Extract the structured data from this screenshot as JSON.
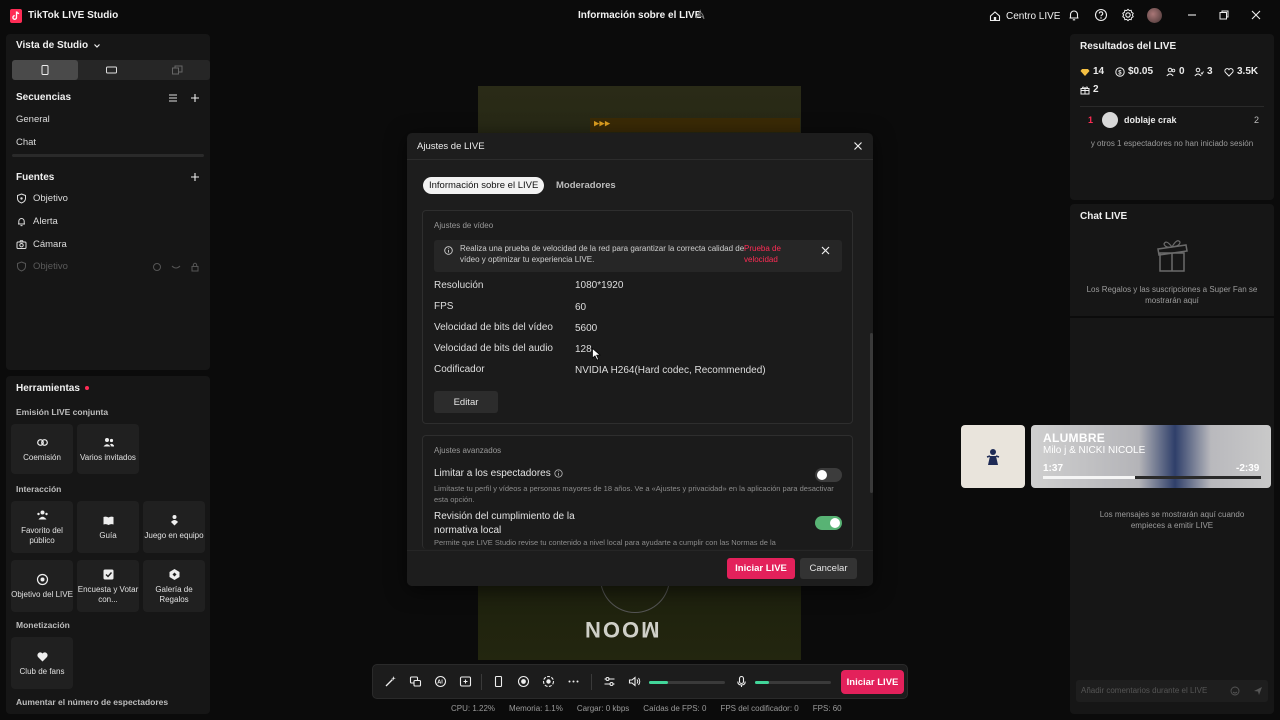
{
  "titlebar": {
    "app_name": "TikTok LIVE Studio",
    "center_title": "Información sobre el LIVE",
    "hub_label": "Centro LIVE"
  },
  "left": {
    "studio_view": "Vista de Studio",
    "sequences_header": "Secuencias",
    "sequences": [
      "General",
      "Chat"
    ],
    "sources_header": "Fuentes",
    "sources": [
      "Objetivo",
      "Alerta",
      "Cámara",
      "Objetivo"
    ],
    "tools_header": "Herramientas",
    "sections": {
      "cohost": "Emisión LIVE conjunta",
      "interaction": "Interacción",
      "monetization": "Monetización",
      "boost": "Aumentar el número de espectadores"
    },
    "tiles": {
      "cohost": [
        "Coemisión",
        "Varios invitados"
      ],
      "interaction": [
        "Favorito del público",
        "Guía",
        "Juego en equipo",
        "Objetivo del LIVE",
        "Encuesta y Votar con...",
        "Galería de Regalos"
      ],
      "monetization": [
        "Club de fans"
      ]
    }
  },
  "preview": {
    "arrows_text": "▶▶▶",
    "bottom_text": "MOON"
  },
  "dialog": {
    "title": "Ajustes de LIVE",
    "tabs": [
      "Información sobre el LIVE",
      "Moderadores"
    ],
    "video_settings_title": "Ajustes de vídeo",
    "notice_text": "Realiza una prueba de velocidad de la red para garantizar la correcta calidad de vídeo y optimizar tu experiencia LIVE.",
    "notice_link": "Prueba de velocidad",
    "settings": [
      {
        "label": "Resolución",
        "value": "1080*1920"
      },
      {
        "label": "FPS",
        "value": "60"
      },
      {
        "label": "Velocidad de bits del vídeo",
        "value": "5600"
      },
      {
        "label": "Velocidad de bits del audio",
        "value": "128"
      },
      {
        "label": "Codificador",
        "value": "NVIDIA H264(Hard codec, Recommended)"
      }
    ],
    "edit_label": "Editar",
    "advanced_title": "Ajustes avanzados",
    "limit_label": "Limitar a los espectadores",
    "limit_desc": "Limítaste tu perfil y vídeos a personas mayores de 18 años. Ve a «Ajustes y privacidad» en la aplicación para desactivar esta opción.",
    "limit_on": false,
    "compliance_label": "Revisión del cumplimiento de la normativa local",
    "compliance_desc": "Permite que LIVE Studio revise tu contenido a nivel local para ayudarte a cumplir con las Normas de la",
    "compliance_on": true,
    "start_label": "Iniciar LIVE",
    "cancel_label": "Cancelar"
  },
  "toolbar": {
    "live_label": "Iniciar LIVE",
    "speaker_level": 0.25,
    "mic_level": 0.18
  },
  "stats": {
    "cpu": "CPU: 1.22%",
    "memory": "Memoria: 1.1%",
    "upload": "Cargar: 0 kbps",
    "fps_drops": "Caídas de FPS: 0",
    "encoder_fps": "FPS del codificador: 0",
    "fps": "FPS: 60"
  },
  "results": {
    "title": "Resultados del LIVE",
    "diamonds": "14",
    "earnings": "$0.05",
    "viewers_new": "0",
    "viewers": "3",
    "likes": "3.5K",
    "gifts": "2",
    "top_rank": "1",
    "top_name": "doblaje crak",
    "top_count": "2",
    "others_text": "y otros 1 espectadores no han iniciado sesión"
  },
  "chat": {
    "title": "Chat LIVE",
    "gifts_placeholder": "Los Regalos y las suscripciones a Super Fan se mostrarán aquí",
    "messages_placeholder": "Los mensajes se mostrarán aquí cuando empieces a emitir LIVE",
    "input_placeholder": "Añadir comentarios durante el LIVE"
  },
  "music": {
    "title": "ALUMBRE",
    "artist": "Milo j & NICKI NICOLE",
    "elapsed": "1:37",
    "remaining": "-2:39",
    "progress": 0.42
  },
  "colors": {
    "accent": "#e3215b",
    "toggle_on": "#58b374",
    "meter": "#42d69a"
  }
}
